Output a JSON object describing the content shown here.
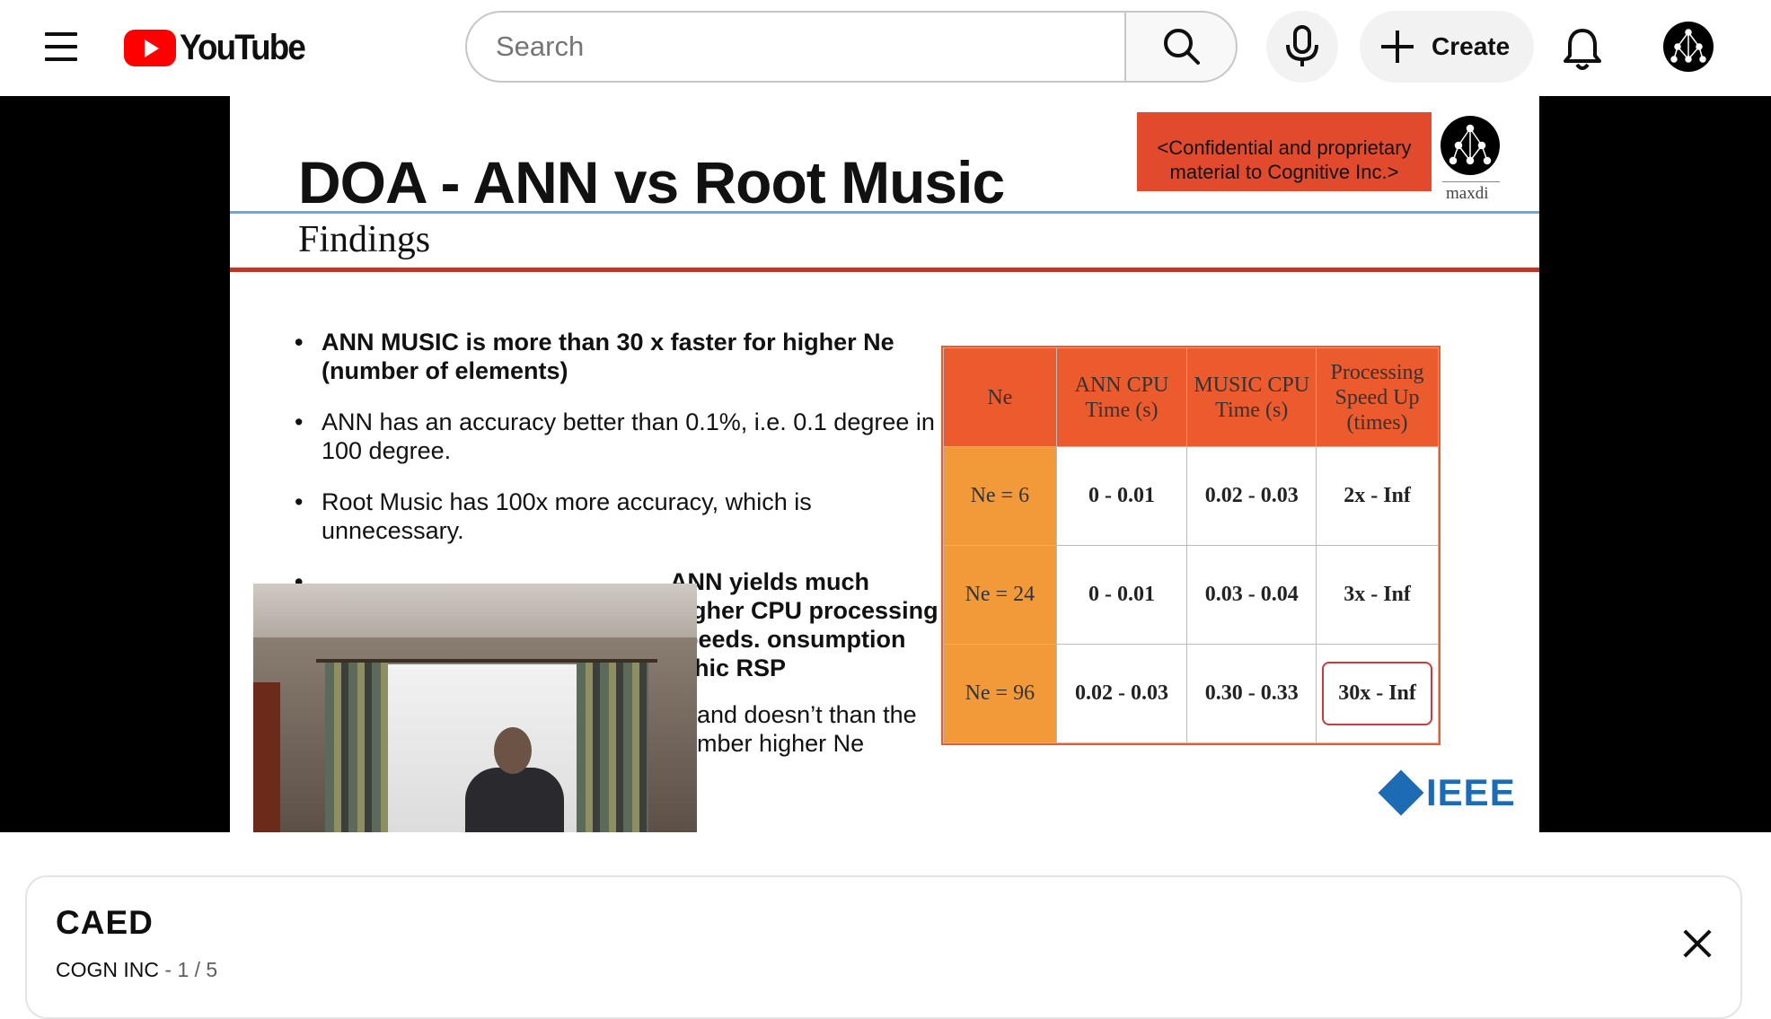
{
  "app": {
    "logo_text": "YouTube"
  },
  "header": {
    "search_placeholder": "Search",
    "create_label": "Create",
    "icons": [
      "menu-icon",
      "search-icon",
      "microphone-icon",
      "plus-icon",
      "bell-icon",
      "avatar-icon"
    ]
  },
  "slide": {
    "title": "DOA - ANN vs Root Music",
    "subtitle": "Findings",
    "confidential": "<Confidential and proprietary material to Cognitive Inc.>",
    "brand": "maxdi",
    "footer_logo": "IEEE",
    "bullets": [
      {
        "text": "ANN MUSIC is more than 30 x faster for higher Ne (number of elements)",
        "bold": true
      },
      {
        "text": "ANN has an accuracy better than 0.1%, i.e. 0.1 degree in 100 degree.",
        "bold": false
      },
      {
        "text": "Root Music has 100x more accuracy, which is unnecessary.",
        "bold": false
      },
      {
        "text": "ANN yields much higher CPU processing speeds. onsumption rphic RSP",
        "bold": true
      },
      {
        "text": "m and doesn’t than the number higher Ne",
        "bold": false
      }
    ],
    "table": {
      "headers": [
        "Ne",
        "ANN CPU Time (s)",
        "MUSIC CPU Time (s)",
        "Processing Speed Up (times)"
      ],
      "rows": [
        [
          "Ne = 6",
          "0 - 0.01",
          "0.02 - 0.03",
          "2x - Inf"
        ],
        [
          "Ne = 24",
          "0 - 0.01",
          "0.03 - 0.04",
          "3x - Inf"
        ],
        [
          "Ne = 96",
          "0.02 - 0.03",
          "0.30 - 0.33",
          "30x - Inf"
        ]
      ]
    }
  },
  "playlist": {
    "title": "CAED",
    "channel": "COGN INC",
    "separator": " - ",
    "position": "1 / 5"
  },
  "colors": {
    "brand_red": "#ff0000",
    "table_header": "#ec5b2d",
    "table_ne": "#f29a3a",
    "ieee_blue": "#1d6bb4"
  }
}
